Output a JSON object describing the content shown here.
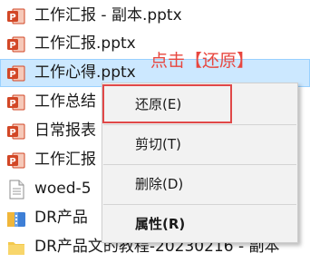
{
  "files": [
    {
      "name": "工作汇报 - 副本.pptx",
      "icon": "powerpoint-icon"
    },
    {
      "name": "工作汇报.pptx",
      "icon": "powerpoint-icon"
    },
    {
      "name": "工作心得.pptx",
      "icon": "powerpoint-icon",
      "selected": true
    },
    {
      "name": "工作总结",
      "icon": "powerpoint-icon"
    },
    {
      "name": "日常报表",
      "icon": "powerpoint-icon"
    },
    {
      "name": "工作汇报",
      "icon": "powerpoint-icon"
    },
    {
      "name": "woed-5",
      "icon": "document-icon"
    },
    {
      "name": "DR产品",
      "icon": "archive-icon"
    },
    {
      "name": "DR产品文的教程-20230216 - 副本",
      "icon": "folder-icon"
    }
  ],
  "context_menu": {
    "restore": "还原(E)",
    "cut": "剪切(T)",
    "delete": "删除(D)",
    "properties": "属性(R)"
  },
  "annotation": {
    "text": "点击【还原】",
    "color": "#e8473f"
  },
  "colors": {
    "selection_bg": "#cce8ff",
    "selection_border": "#99d1ff",
    "highlight_border": "#e04848",
    "powerpoint": "#d24726"
  }
}
